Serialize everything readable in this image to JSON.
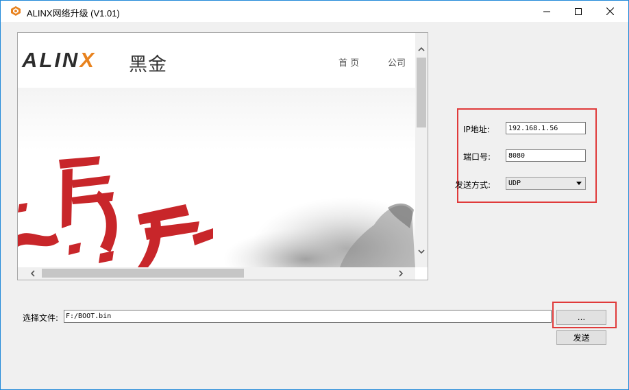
{
  "window": {
    "title": "ALINX网络升级 (V1.01)",
    "icons": {
      "app": "alinx-app-icon",
      "minimize": "minimize-icon",
      "maximize": "maximize-icon",
      "close": "close-icon"
    }
  },
  "browser": {
    "logo_text": "ALINX",
    "logo_cn": "黑金",
    "nav": [
      "首 页",
      "公司"
    ],
    "scroll_icons": {
      "up": "chevron-up-icon",
      "down": "chevron-down-icon",
      "left": "chevron-left-icon",
      "right": "chevron-right-icon"
    }
  },
  "settings": {
    "ip_label": "IP地址:",
    "ip_value": "192.168.1.56",
    "port_label": "端口号:",
    "port_value": "8080",
    "mode_label": "发送方式:",
    "mode_value": "UDP"
  },
  "file": {
    "label": "选择文件:",
    "path": "F:/BOOT.bin",
    "browse_label": "...",
    "send_label": "发送"
  },
  "colors": {
    "highlight": "#e03a3a",
    "accent": "#e8821e",
    "calligraphy": "#c8262a"
  }
}
